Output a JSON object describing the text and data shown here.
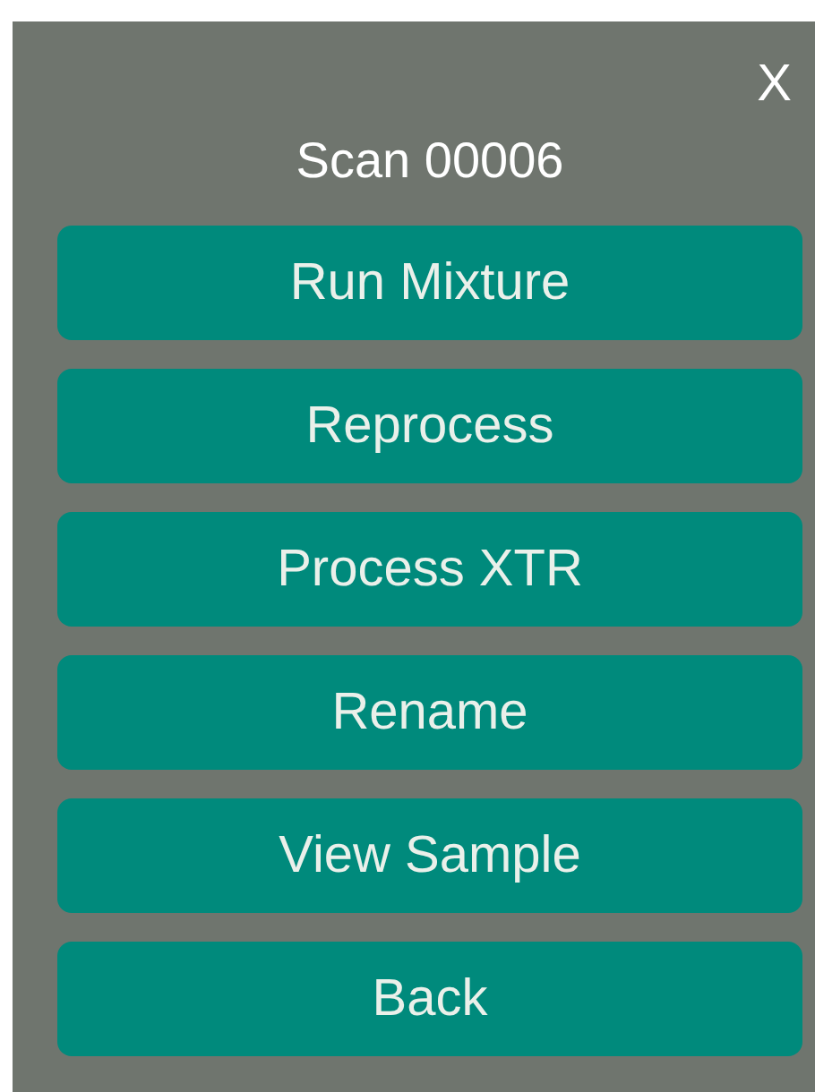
{
  "dialog": {
    "close": "X",
    "title": "Scan 00006",
    "buttons": [
      "Run Mixture",
      "Reprocess",
      "Process XTR",
      "Rename",
      "View Sample",
      "Back"
    ]
  }
}
